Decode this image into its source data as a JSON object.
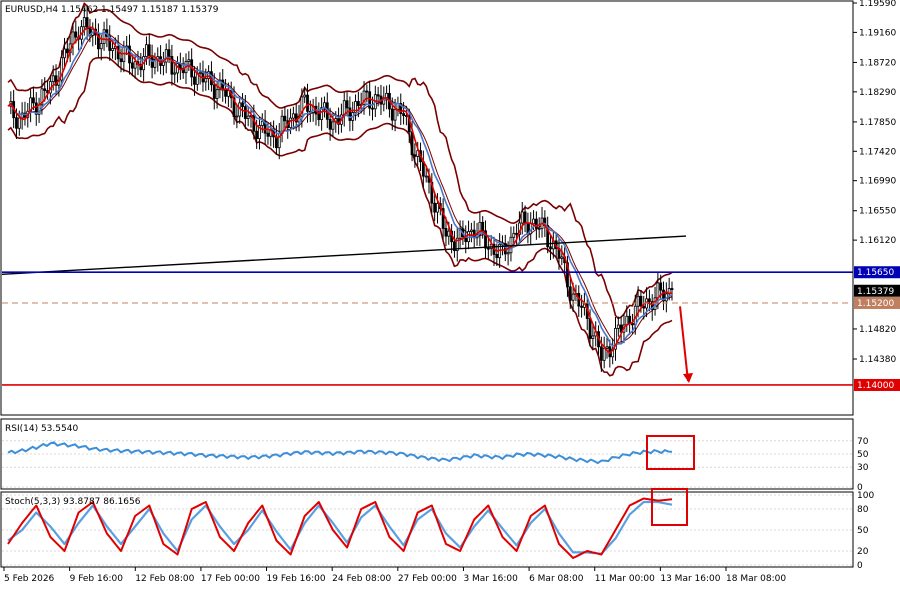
{
  "chart_data": [
    {
      "type": "candlestick",
      "symbol_line": "EURUSD,H4  1.15462 1.15497 1.15187 1.15379",
      "ylim": [
        1.1359,
        1.1959
      ],
      "y_ticks": [
        "1.19590",
        "1.19160",
        "1.18720",
        "1.18290",
        "1.17850",
        "1.17420",
        "1.16990",
        "1.16550",
        "1.16120",
        "1.15650",
        "1.15379",
        "1.15200",
        "1.14820",
        "1.14380",
        "1.14000"
      ],
      "x_ticks": [
        "5 Feb 2026",
        "9 Feb 16:00",
        "12 Feb 08:00",
        "17 Feb 00:00",
        "19 Feb 16:00",
        "24 Feb 08:00",
        "27 Feb 00:00",
        "3 Mar 16:00",
        "6 Mar 08:00",
        "11 Mar 00:00",
        "13 Mar 16:00",
        "18 Mar 08:00"
      ],
      "price_path": [
        1.18,
        1.179,
        1.1815,
        1.1835,
        1.188,
        1.1925,
        1.1915,
        1.19,
        1.1885,
        1.187,
        1.188,
        1.1875,
        1.1865,
        1.186,
        1.1845,
        1.1835,
        1.181,
        1.179,
        1.177,
        1.1765,
        1.179,
        1.181,
        1.18,
        1.1785,
        1.18,
        1.1815,
        1.182,
        1.181,
        1.1795,
        1.173,
        1.168,
        1.162,
        1.161,
        1.163,
        1.1605,
        1.159,
        1.163,
        1.164,
        1.1625,
        1.159,
        1.153,
        1.15,
        1.144,
        1.147,
        1.15,
        1.152,
        1.153,
        1.154
      ],
      "horizontal_levels": [
        {
          "price": 1.1565,
          "label": "1.15650",
          "color": "#0000b4",
          "style": "solid"
        },
        {
          "price": 1.152,
          "label": "1.15200",
          "color": "#c08060",
          "style": "dashed"
        },
        {
          "price": 1.14,
          "label": "1.14000",
          "color": "#e00000",
          "style": "solid"
        }
      ],
      "current_price": {
        "price": 1.15379,
        "label": "1.15379"
      },
      "trendline": {
        "from": [
          0,
          1.1562
        ],
        "to": [
          47,
          1.1618
        ],
        "color": "#000000"
      },
      "overlays": [
        "Bollinger Bands",
        "fast MA (red)",
        "slow MA (blue)"
      ],
      "arrow": {
        "direction": "down",
        "color": "#e00000"
      }
    },
    {
      "type": "line",
      "title": "RSI(14) 53.5540",
      "ylim": [
        0,
        100
      ],
      "y_ticks": [
        "70",
        "50",
        "30",
        "0"
      ],
      "values": [
        52,
        55,
        60,
        66,
        64,
        62,
        58,
        56,
        55,
        54,
        53,
        52,
        51,
        50,
        48,
        47,
        46,
        45,
        46,
        48,
        51,
        53,
        52,
        51,
        52,
        54,
        53,
        52,
        50,
        46,
        43,
        41,
        44,
        48,
        46,
        45,
        49,
        50,
        48,
        46,
        42,
        40,
        38,
        45,
        50,
        53,
        54,
        53.554
      ]
    },
    {
      "type": "line",
      "title": "Stoch(5,3,3) 93.8787 86.1656",
      "ylim": [
        0,
        100
      ],
      "y_ticks": [
        "100",
        "80",
        "50",
        "20",
        "0"
      ],
      "series": [
        {
          "values": [
            30,
            60,
            85,
            40,
            20,
            75,
            90,
            45,
            20,
            70,
            85,
            30,
            15,
            80,
            90,
            40,
            20,
            60,
            85,
            35,
            15,
            70,
            90,
            50,
            25,
            80,
            90,
            40,
            20,
            75,
            85,
            30,
            20,
            65,
            85,
            40,
            20,
            70,
            85,
            30,
            10,
            20,
            15,
            50,
            85,
            95,
            92,
            93.8787
          ]
        },
        {
          "values": [
            35,
            50,
            75,
            55,
            30,
            60,
            85,
            55,
            30,
            55,
            80,
            45,
            20,
            65,
            85,
            55,
            30,
            50,
            78,
            48,
            22,
            60,
            85,
            60,
            32,
            68,
            85,
            55,
            28,
            65,
            80,
            45,
            25,
            55,
            78,
            52,
            28,
            60,
            80,
            45,
            18,
            18,
            16,
            38,
            72,
            90,
            90,
            86.1656
          ]
        }
      ]
    }
  ],
  "colors": {
    "candle": "#000000",
    "bollinger": "#7a0000",
    "ma_fast": "#e00000",
    "ma_slow": "#4a78c8",
    "rsi": "#3c8fd8",
    "stoch_main": "#e00000",
    "stoch_signal": "#5aa0e0",
    "box": "#e00000",
    "grid": "#d8d8d8"
  }
}
